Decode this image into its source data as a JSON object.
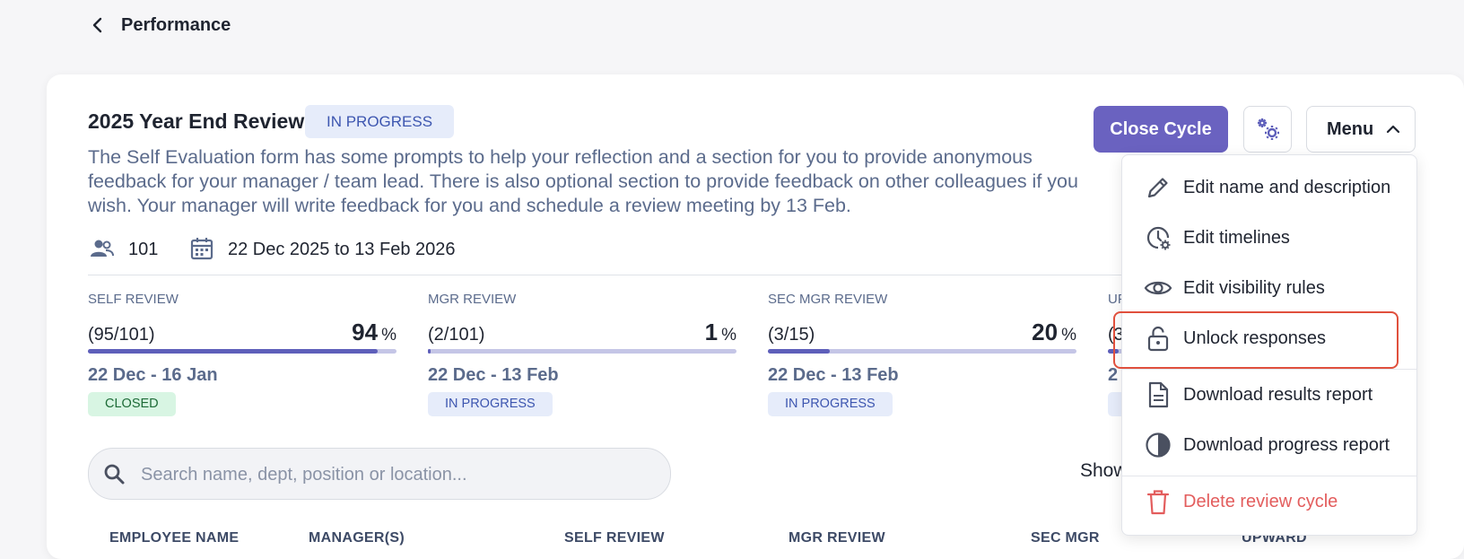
{
  "header": {
    "title": "Performance"
  },
  "cycle": {
    "title": "2025 Year End Review",
    "status": "IN PROGRESS",
    "description": "The Self Evaluation form has some prompts to help your reflection and a section for you to provide anonymous feedback for your manager / team lead. There is also optional section to provide feedback on other colleagues if you wish. Your manager will write feedback for you and schedule a review meeting by 13 Feb.",
    "participants": "101",
    "date_range": "22 Dec 2025 to 13 Feb 2026"
  },
  "stages": [
    {
      "label": "SELF REVIEW",
      "count": "(95/101)",
      "percent": "94",
      "percent_sign": "%",
      "progress": 0.94,
      "dates": "22 Dec - 16 Jan",
      "status": "CLOSED"
    },
    {
      "label": "MGR REVIEW",
      "count": "(2/101)",
      "percent": "1",
      "percent_sign": "%",
      "progress": 0.01,
      "dates": "22 Dec - 13 Feb",
      "status": "IN PROGRESS"
    },
    {
      "label": "SEC MGR REVIEW",
      "count": "(3/15)",
      "percent": "20",
      "percent_sign": "%",
      "progress": 0.2,
      "dates": "22 Dec - 13 Feb",
      "status": "IN PROGRESS"
    },
    {
      "label": "UP",
      "count": "(3",
      "dates": "2",
      "progress": 0.2
    }
  ],
  "search": {
    "placeholder": "Search name, dept, position or location..."
  },
  "show_label": "Show",
  "table_headers": [
    "EMPLOYEE NAME",
    "MANAGER(S)",
    "SELF REVIEW",
    "MGR REVIEW",
    "SEC MGR",
    "UPWARD"
  ],
  "actions": {
    "close_cycle": "Close Cycle",
    "menu": "Menu"
  },
  "menu_items": [
    {
      "label": "Edit name and description",
      "icon": "pencil-icon"
    },
    {
      "label": "Edit timelines",
      "icon": "clock-gear-icon"
    },
    {
      "label": "Edit visibility rules",
      "icon": "eye-icon"
    },
    {
      "label": "Unlock responses",
      "icon": "unlock-icon"
    },
    {
      "label": "Download results report",
      "icon": "document-icon"
    },
    {
      "label": "Download progress report",
      "icon": "pie-chart-icon"
    },
    {
      "label": "Delete review cycle",
      "icon": "trash-icon"
    }
  ],
  "colors": {
    "accent": "#6a62c0",
    "danger": "#e35d5d",
    "highlight": "#e0503d"
  }
}
